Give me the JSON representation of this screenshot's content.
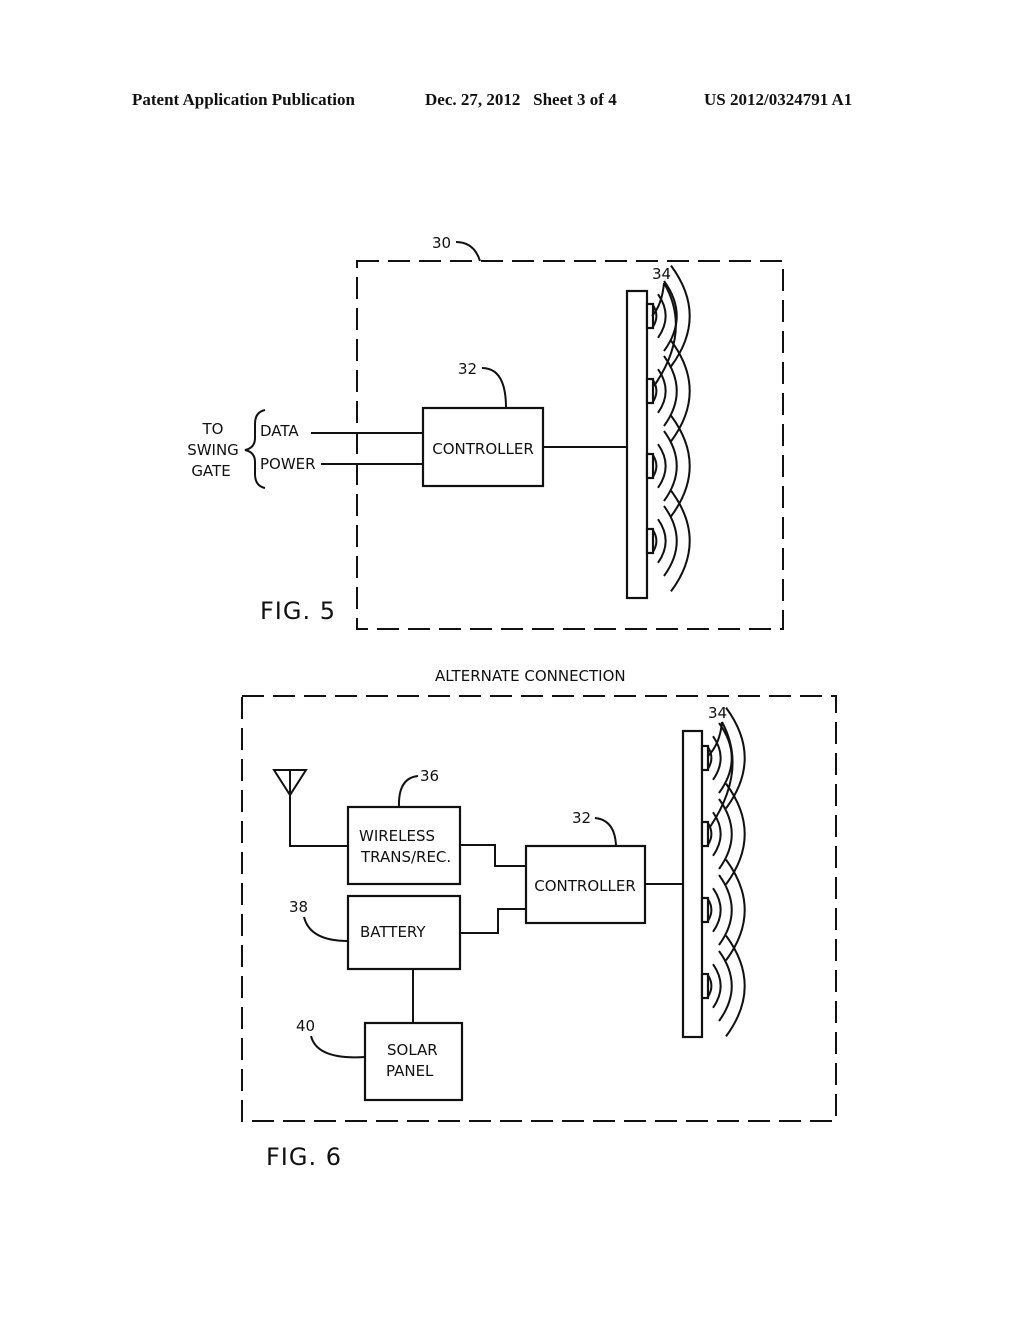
{
  "header": {
    "publication": "Patent Application Publication",
    "date_sheet": "Dec. 27, 2012   Sheet 3 of 4",
    "number": "US 2012/0324791 A1"
  },
  "fig5": {
    "caption": "FIG. 5",
    "enclosure_ref": "30",
    "controller_ref": "32",
    "emitters_ref": "34",
    "controller_label": "CONTROLLER",
    "to_label": [
      "TO",
      "SWING",
      "GATE"
    ],
    "data_label": "DATA",
    "power_label": "POWER",
    "emitter_count": 4
  },
  "fig6": {
    "caption": "FIG. 6",
    "title": "ALTERNATE CONNECTION",
    "wireless_ref": "36",
    "controller_ref": "32",
    "battery_ref": "38",
    "solar_ref": "40",
    "emitters_ref": "34",
    "wireless_label_1": "WIRELESS",
    "wireless_label_2": "TRANS/REC.",
    "controller_label": "CONTROLLER",
    "battery_label": "BATTERY",
    "solar_label_1": "SOLAR",
    "solar_label_2": "PANEL",
    "emitter_count": 4
  }
}
